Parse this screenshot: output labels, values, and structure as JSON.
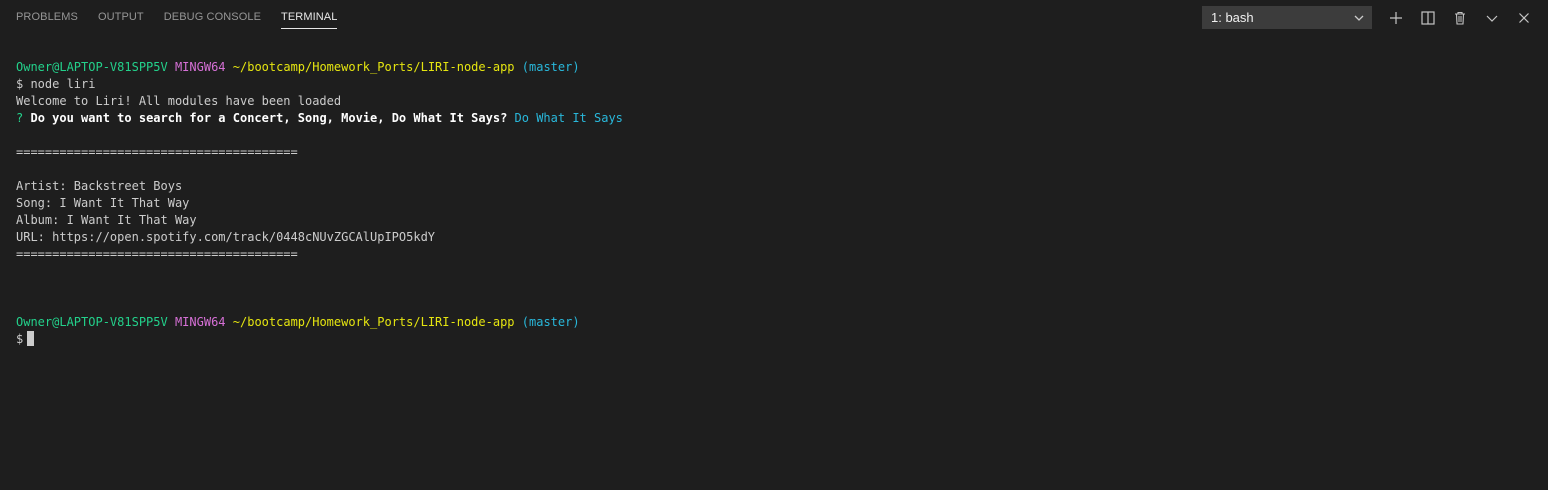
{
  "tabs": [
    {
      "label": "PROBLEMS",
      "active": false
    },
    {
      "label": "OUTPUT",
      "active": false
    },
    {
      "label": "DEBUG CONSOLE",
      "active": false
    },
    {
      "label": "TERMINAL",
      "active": true
    }
  ],
  "terminal_select": {
    "value": "1: bash"
  },
  "actions": [
    {
      "icon": "add-icon"
    },
    {
      "icon": "split-icon"
    },
    {
      "icon": "trash-icon"
    },
    {
      "icon": "chevron-down-icon"
    },
    {
      "icon": "close-icon"
    }
  ],
  "prompt": {
    "user": "Owner@LAPTOP-V81SPP5V",
    "env": "MINGW64",
    "path": "~/bootcamp/Homework_Ports/LIRI-node-app",
    "branch": "(master)",
    "symbol": "$"
  },
  "output": {
    "command": "$ node liri",
    "welcome": "Welcome to Liri! All modules have been loaded",
    "question_mark": "?",
    "question": "Do you want to search for a Concert, Song, Movie, Do What It Says?",
    "answer": "Do What It Says",
    "separator_top": "=======================================",
    "artist": "Artist: Backstreet Boys",
    "song": "Song: I Want It That Way",
    "album": "Album: I Want It That Way",
    "url": "URL: https://open.spotify.com/track/0448cNUvZGCAlUpIPO5kdY",
    "separator_bottom": "======================================="
  },
  "colors": {
    "background": "#1e1e1e",
    "user": "#23d18b",
    "env": "#d670d6",
    "path": "#e5e510",
    "branch": "#29b8db"
  }
}
